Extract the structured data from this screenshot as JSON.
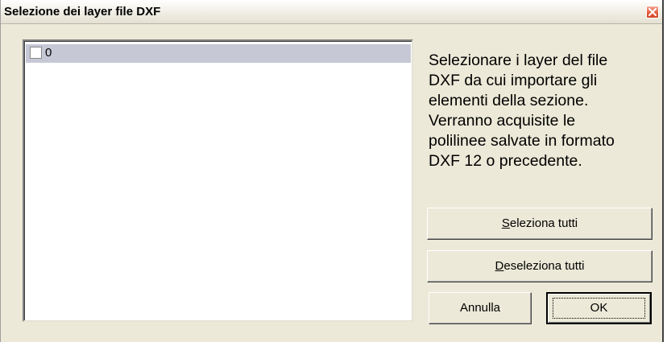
{
  "window": {
    "title": "Selezione dei layer file DXF",
    "close_icon": "close-icon",
    "close_color": "#d9542f"
  },
  "layers": {
    "items": [
      {
        "label": "0",
        "checked": false,
        "selected": true
      }
    ],
    "selection_color": "#c6c8d6"
  },
  "instructions": {
    "text": "Selezionare i layer del file\nDXF da cui importare gli\nelementi della sezione.\nVerranno acquisite le\npolilinee salvate in formato\nDXF 12 o precedente."
  },
  "buttons": {
    "select_all": {
      "accel": "S",
      "rest": "eleziona tutti"
    },
    "deselect_all": {
      "accel": "D",
      "rest": "eseleziona tutti"
    },
    "cancel": "Annulla",
    "ok": "OK"
  }
}
